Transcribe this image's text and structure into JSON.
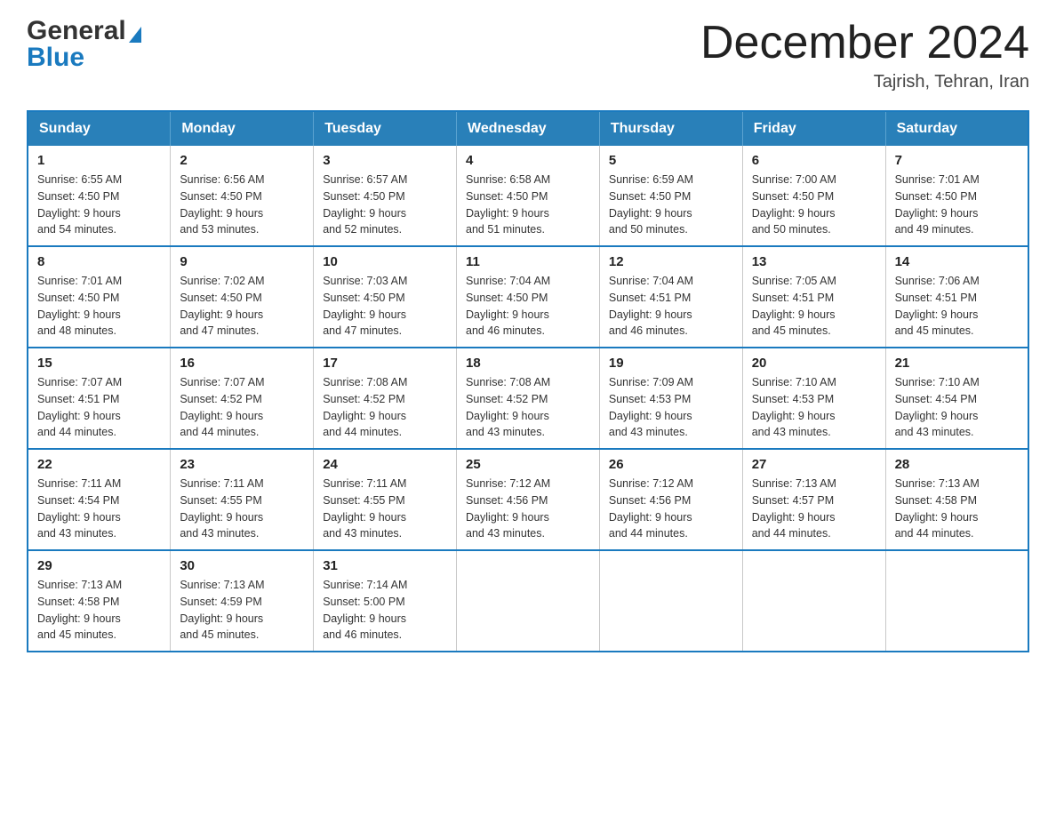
{
  "header": {
    "logo_general": "General",
    "logo_blue": "Blue",
    "month_title": "December 2024",
    "location": "Tajrish, Tehran, Iran"
  },
  "calendar": {
    "days_of_week": [
      "Sunday",
      "Monday",
      "Tuesday",
      "Wednesday",
      "Thursday",
      "Friday",
      "Saturday"
    ],
    "weeks": [
      [
        {
          "day": "1",
          "sunrise": "6:55 AM",
          "sunset": "4:50 PM",
          "daylight": "9 hours and 54 minutes."
        },
        {
          "day": "2",
          "sunrise": "6:56 AM",
          "sunset": "4:50 PM",
          "daylight": "9 hours and 53 minutes."
        },
        {
          "day": "3",
          "sunrise": "6:57 AM",
          "sunset": "4:50 PM",
          "daylight": "9 hours and 52 minutes."
        },
        {
          "day": "4",
          "sunrise": "6:58 AM",
          "sunset": "4:50 PM",
          "daylight": "9 hours and 51 minutes."
        },
        {
          "day": "5",
          "sunrise": "6:59 AM",
          "sunset": "4:50 PM",
          "daylight": "9 hours and 50 minutes."
        },
        {
          "day": "6",
          "sunrise": "7:00 AM",
          "sunset": "4:50 PM",
          "daylight": "9 hours and 50 minutes."
        },
        {
          "day": "7",
          "sunrise": "7:01 AM",
          "sunset": "4:50 PM",
          "daylight": "9 hours and 49 minutes."
        }
      ],
      [
        {
          "day": "8",
          "sunrise": "7:01 AM",
          "sunset": "4:50 PM",
          "daylight": "9 hours and 48 minutes."
        },
        {
          "day": "9",
          "sunrise": "7:02 AM",
          "sunset": "4:50 PM",
          "daylight": "9 hours and 47 minutes."
        },
        {
          "day": "10",
          "sunrise": "7:03 AM",
          "sunset": "4:50 PM",
          "daylight": "9 hours and 47 minutes."
        },
        {
          "day": "11",
          "sunrise": "7:04 AM",
          "sunset": "4:50 PM",
          "daylight": "9 hours and 46 minutes."
        },
        {
          "day": "12",
          "sunrise": "7:04 AM",
          "sunset": "4:51 PM",
          "daylight": "9 hours and 46 minutes."
        },
        {
          "day": "13",
          "sunrise": "7:05 AM",
          "sunset": "4:51 PM",
          "daylight": "9 hours and 45 minutes."
        },
        {
          "day": "14",
          "sunrise": "7:06 AM",
          "sunset": "4:51 PM",
          "daylight": "9 hours and 45 minutes."
        }
      ],
      [
        {
          "day": "15",
          "sunrise": "7:07 AM",
          "sunset": "4:51 PM",
          "daylight": "9 hours and 44 minutes."
        },
        {
          "day": "16",
          "sunrise": "7:07 AM",
          "sunset": "4:52 PM",
          "daylight": "9 hours and 44 minutes."
        },
        {
          "day": "17",
          "sunrise": "7:08 AM",
          "sunset": "4:52 PM",
          "daylight": "9 hours and 44 minutes."
        },
        {
          "day": "18",
          "sunrise": "7:08 AM",
          "sunset": "4:52 PM",
          "daylight": "9 hours and 43 minutes."
        },
        {
          "day": "19",
          "sunrise": "7:09 AM",
          "sunset": "4:53 PM",
          "daylight": "9 hours and 43 minutes."
        },
        {
          "day": "20",
          "sunrise": "7:10 AM",
          "sunset": "4:53 PM",
          "daylight": "9 hours and 43 minutes."
        },
        {
          "day": "21",
          "sunrise": "7:10 AM",
          "sunset": "4:54 PM",
          "daylight": "9 hours and 43 minutes."
        }
      ],
      [
        {
          "day": "22",
          "sunrise": "7:11 AM",
          "sunset": "4:54 PM",
          "daylight": "9 hours and 43 minutes."
        },
        {
          "day": "23",
          "sunrise": "7:11 AM",
          "sunset": "4:55 PM",
          "daylight": "9 hours and 43 minutes."
        },
        {
          "day": "24",
          "sunrise": "7:11 AM",
          "sunset": "4:55 PM",
          "daylight": "9 hours and 43 minutes."
        },
        {
          "day": "25",
          "sunrise": "7:12 AM",
          "sunset": "4:56 PM",
          "daylight": "9 hours and 43 minutes."
        },
        {
          "day": "26",
          "sunrise": "7:12 AM",
          "sunset": "4:56 PM",
          "daylight": "9 hours and 44 minutes."
        },
        {
          "day": "27",
          "sunrise": "7:13 AM",
          "sunset": "4:57 PM",
          "daylight": "9 hours and 44 minutes."
        },
        {
          "day": "28",
          "sunrise": "7:13 AM",
          "sunset": "4:58 PM",
          "daylight": "9 hours and 44 minutes."
        }
      ],
      [
        {
          "day": "29",
          "sunrise": "7:13 AM",
          "sunset": "4:58 PM",
          "daylight": "9 hours and 45 minutes."
        },
        {
          "day": "30",
          "sunrise": "7:13 AM",
          "sunset": "4:59 PM",
          "daylight": "9 hours and 45 minutes."
        },
        {
          "day": "31",
          "sunrise": "7:14 AM",
          "sunset": "5:00 PM",
          "daylight": "9 hours and 46 minutes."
        },
        null,
        null,
        null,
        null
      ]
    ]
  },
  "labels": {
    "sunrise": "Sunrise:",
    "sunset": "Sunset:",
    "daylight": "Daylight:"
  }
}
